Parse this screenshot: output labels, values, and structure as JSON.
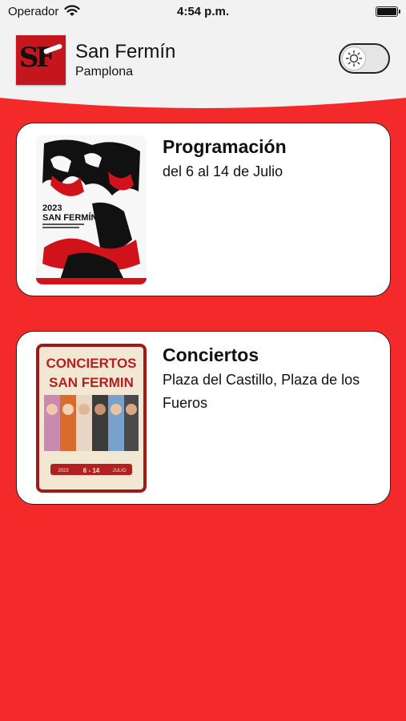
{
  "status_bar": {
    "carrier": "Operador",
    "time": "4:54 p.m."
  },
  "header": {
    "title": "San Fermín",
    "subtitle": "Pamplona",
    "logo_text": "SF",
    "theme_toggle_icon": "sun-icon"
  },
  "cards": [
    {
      "title": "Programación",
      "description": "del 6 al 14 de Julio",
      "poster": {
        "year": "2023",
        "name": "SAN FERMÍN"
      }
    },
    {
      "title": "Conciertos",
      "description": "Plaza del Castillo, Plaza de los Fueros",
      "poster": {
        "heading_line1": "CONCIERTOS",
        "heading_line2": "SAN FERMIN",
        "year": "2023",
        "dates": "6 - 14",
        "month": "JULIO"
      }
    }
  ],
  "colors": {
    "background": "#f42a2a",
    "header_bg": "#f2f2f2",
    "card_bg": "#ffffff",
    "logo_red": "#c4161c",
    "poster_red": "#9e1b1b",
    "poster_cream": "#f1e7d3"
  }
}
